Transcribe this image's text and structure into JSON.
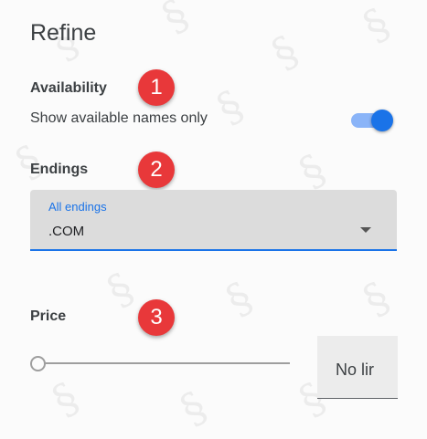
{
  "panel": {
    "title": "Refine"
  },
  "availability": {
    "label": "Availability",
    "toggle_text": "Show available names only",
    "toggle_on": true,
    "badge": "1"
  },
  "endings": {
    "label": "Endings",
    "select_label": "All endings",
    "select_value": ".COM",
    "badge": "2"
  },
  "price": {
    "label": "Price",
    "limit_text": "No lir",
    "slider_level": 0,
    "badge": "3"
  },
  "icons": {
    "select_arrow": "triangle-down-icon"
  },
  "colors": {
    "accent": "#1a73e8",
    "toggle_track": "#8ab4f8",
    "badge": "#e8383a"
  }
}
